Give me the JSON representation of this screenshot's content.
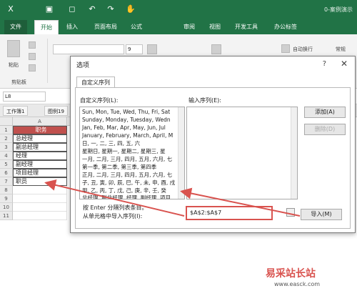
{
  "window": {
    "doc_title": "0-案例演示"
  },
  "ribbon_tabs": [
    "文件",
    "开始",
    "插入",
    "页面布局",
    "公式",
    "审阅",
    "视图",
    "开发工具",
    "办公标签"
  ],
  "ribbon": {
    "paste_label": "粘贴",
    "clipboard_label": "剪贴板",
    "font_size": "9",
    "wrap_text_label": "自动换行",
    "number_format": "常规"
  },
  "formula_bar": {
    "name_box": "L8"
  },
  "workbook_tabs": [
    "工作簿1",
    "图例19"
  ],
  "sheet": {
    "col_a": "A",
    "rows": [
      "1",
      "2",
      "3",
      "4",
      "5",
      "6",
      "7",
      "8",
      "9",
      "10",
      "11"
    ],
    "cells": [
      "职务",
      "总经理",
      "副总经理",
      "经理",
      "副经理",
      "项目经理",
      "职员"
    ]
  },
  "dialog": {
    "title": "选项",
    "help": "?",
    "close": "✕",
    "tab": "自定义序列",
    "list_label": "自定义序列(L):",
    "entries_label": "输入序列(E):",
    "list_items": [
      "Sun, Mon, Tue, Wed, Thu, Fri, Sat",
      "Sunday, Monday, Tuesday, Wedn",
      "Jan, Feb, Mar, Apr, May, Jun, Jul",
      "January, February, March, April, M",
      "日, 一, 二, 三, 四, 五, 六",
      "星期日, 星期一, 星期二, 星期三, 星",
      "一月, 二月, 三月, 四月, 五月, 六月, 七",
      "第一季, 第二季, 第三季, 第四季",
      "正月, 二月, 三月, 四月, 五月, 六月, 七",
      "子, 丑, 寅, 卯, 辰, 巳, 午, 未, 申, 酉, 戌",
      "甲, 乙, 丙, 丁, 戊, 己, 庚, 辛, 壬, 癸",
      "总经理, 副总经理, 经理, 副经理, 项目"
    ],
    "add_button": "添加(A)",
    "delete_button": "删除(D)",
    "hint": "按 Enter 分隔列表条目。",
    "import_label": "从单元格中导入序列(I):",
    "import_range": "$A$2:$A$7",
    "import_button": "导入(M)"
  },
  "watermark": {
    "line1": "易采站长站",
    "line2": "www.easck.com"
  },
  "colors": {
    "excel_green": "#217346",
    "header_fill": "#c0504d",
    "arrow": "#d9534f"
  }
}
